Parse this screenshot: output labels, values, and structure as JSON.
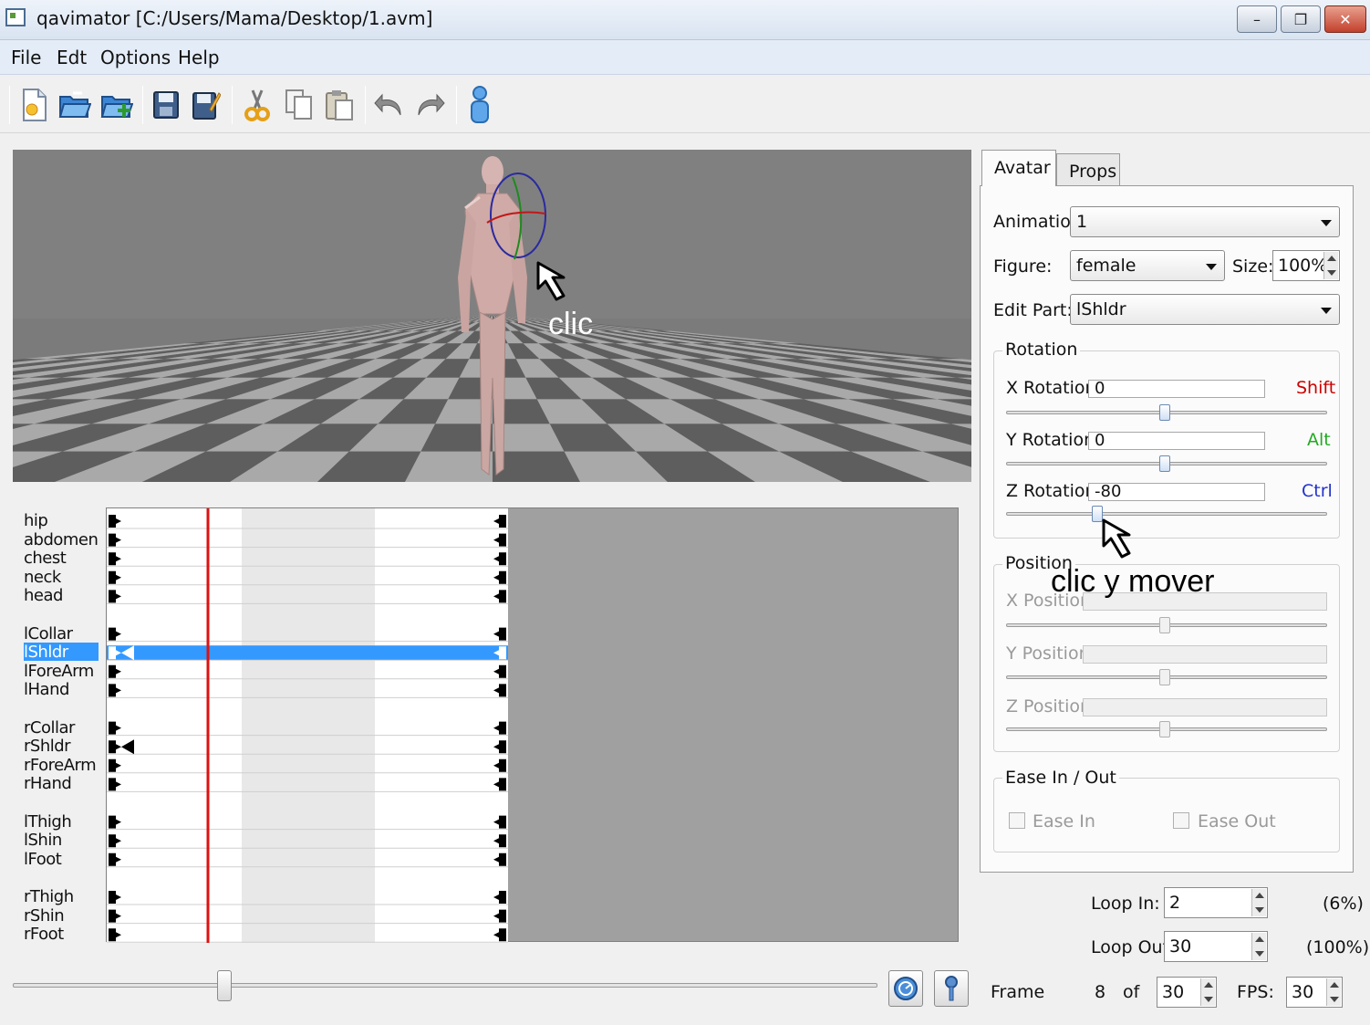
{
  "window": {
    "title": "qavimator [C:/Users/Mama/Desktop/1.avm]",
    "minimize_glyph": "–",
    "maximize_glyph": "❐",
    "close_glyph": "✕"
  },
  "menu": [
    "File",
    "Edt",
    "Options",
    "Help"
  ],
  "toolbar": {
    "icons": [
      "new-file-icon",
      "open-folder-icon",
      "add-folder-icon",
      "save-icon",
      "save-as-icon",
      "cut-icon",
      "copy-icon",
      "paste-icon",
      "undo-icon",
      "redo-icon",
      "figure-icon"
    ]
  },
  "annotations": {
    "viewport_hint": "clic",
    "slider_hint": "clic y mover"
  },
  "timeline": {
    "parts": [
      {
        "label": "hip",
        "group": 0
      },
      {
        "label": "abdomen",
        "group": 0
      },
      {
        "label": "chest",
        "group": 0
      },
      {
        "label": "neck",
        "group": 0
      },
      {
        "label": "head",
        "group": 0
      },
      {
        "label": "lCollar",
        "group": 1
      },
      {
        "label": "lShldr",
        "group": 1,
        "selected": true
      },
      {
        "label": "lForeArm",
        "group": 1
      },
      {
        "label": "lHand",
        "group": 1
      },
      {
        "label": "rCollar",
        "group": 2
      },
      {
        "label": "rShldr",
        "group": 2
      },
      {
        "label": "rForeArm",
        "group": 2
      },
      {
        "label": "rHand",
        "group": 2
      },
      {
        "label": "lThigh",
        "group": 3
      },
      {
        "label": "lShin",
        "group": 3
      },
      {
        "label": "lFoot",
        "group": 3
      },
      {
        "label": "rThigh",
        "group": 4
      },
      {
        "label": "rShin",
        "group": 4
      },
      {
        "label": "rFoot",
        "group": 4
      }
    ],
    "playhead_color": "#e01010",
    "selection_color": "#3399ff"
  },
  "panel": {
    "tabs": [
      "Avatar",
      "Props"
    ],
    "active_tab": "Avatar",
    "animation_label": "Animation:",
    "animation_value": "1",
    "figure_label": "Figure:",
    "figure_value": "female",
    "size_label": "Size:",
    "size_value": "100%",
    "edit_part_label": "Edit Part:",
    "edit_part_value": "lShldr",
    "rotation": {
      "title": "Rotation",
      "x_label": "X Rotation:",
      "x_value": "0",
      "x_mod": "Shift",
      "x_mod_color": "#cc0000",
      "y_label": "Y Rotation:",
      "y_value": "0",
      "y_mod": "Alt",
      "y_mod_color": "#22aa22",
      "z_label": "Z Rotation:",
      "z_value": "-80",
      "z_mod": "Ctrl",
      "z_mod_color": "#2233cc"
    },
    "position": {
      "title": "Position",
      "x_label": "X Position:",
      "y_label": "Y Position:",
      "z_label": "Z Position:"
    },
    "ease": {
      "title": "Ease In / Out",
      "ease_in": "Ease In",
      "ease_out": "Ease Out"
    }
  },
  "loop": {
    "in_label": "Loop In:",
    "in_value": "2",
    "in_pct": "(6%)",
    "out_label": "Loop Out:",
    "out_value": "30",
    "out_pct": "(100%)"
  },
  "playback": {
    "frame_label": "Frame",
    "frame_value": "8",
    "of_label": "of",
    "total_frames": "30",
    "fps_label": "FPS:",
    "fps_value": "30"
  }
}
